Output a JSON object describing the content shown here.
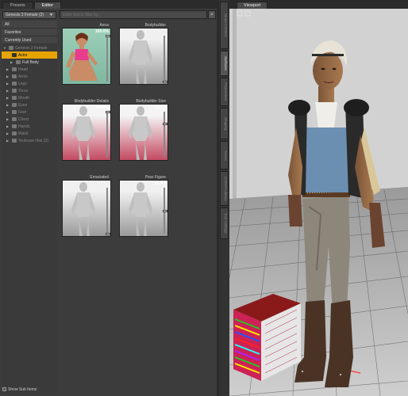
{
  "left_tabs": [
    "Presets",
    "Editor"
  ],
  "figure_selector": "Genesis 3 Female (2)",
  "search_placeholder": "Enter text to filter by...",
  "categories": [
    "All",
    "Favorites",
    "Currently Used"
  ],
  "tree": [
    {
      "label": "Genesis 3 Female",
      "state": "root"
    },
    {
      "label": "Actor",
      "state": "selected"
    },
    {
      "label": "Full Body",
      "state": "child"
    },
    {
      "label": "Head",
      "state": "dim"
    },
    {
      "label": "Arms",
      "state": "dim"
    },
    {
      "label": "Legs",
      "state": "dim"
    },
    {
      "label": "Torso",
      "state": "dim"
    },
    {
      "label": "Mouth",
      "state": "dim"
    },
    {
      "label": "Eyes",
      "state": "dim"
    },
    {
      "label": "Feet",
      "state": "dim"
    },
    {
      "label": "Chest",
      "state": "dim"
    },
    {
      "label": "Hands",
      "state": "dim"
    },
    {
      "label": "Waist",
      "state": "dim"
    },
    {
      "label": "Toulouse Hair (2)",
      "state": "dim"
    }
  ],
  "show_sub_items": "Show Sub Items",
  "morphs": [
    {
      "name": "Anna",
      "value": "100.0%",
      "level": 1.0,
      "thumb": "girl"
    },
    {
      "name": "Bodybuilder",
      "value": "",
      "level": 0.0,
      "thumb": "figure"
    },
    {
      "name": "Bodybuilder Details",
      "value": "100.0%",
      "level": 1.0,
      "thumb": "figure-pink"
    },
    {
      "name": "Bodybuilder Size",
      "value": "75.0%",
      "level": 0.75,
      "thumb": "figure-pink"
    },
    {
      "name": "Emaciated",
      "value": "",
      "level": 0.0,
      "thumb": "figure"
    },
    {
      "name": "Pear Figure",
      "value": "50.0%",
      "level": 0.5,
      "thumb": "figure"
    }
  ],
  "right_tabs": [
    "Smart Content",
    "Surfaces",
    "Parameters",
    "Shaping",
    "Scene",
    "Content Library",
    "Tool Settings"
  ],
  "viewport": {
    "tab": "Viewport"
  },
  "colors": {
    "selection": "#e7a400",
    "panel": "#3c3c3c",
    "viewport": "#6a6a6a"
  }
}
